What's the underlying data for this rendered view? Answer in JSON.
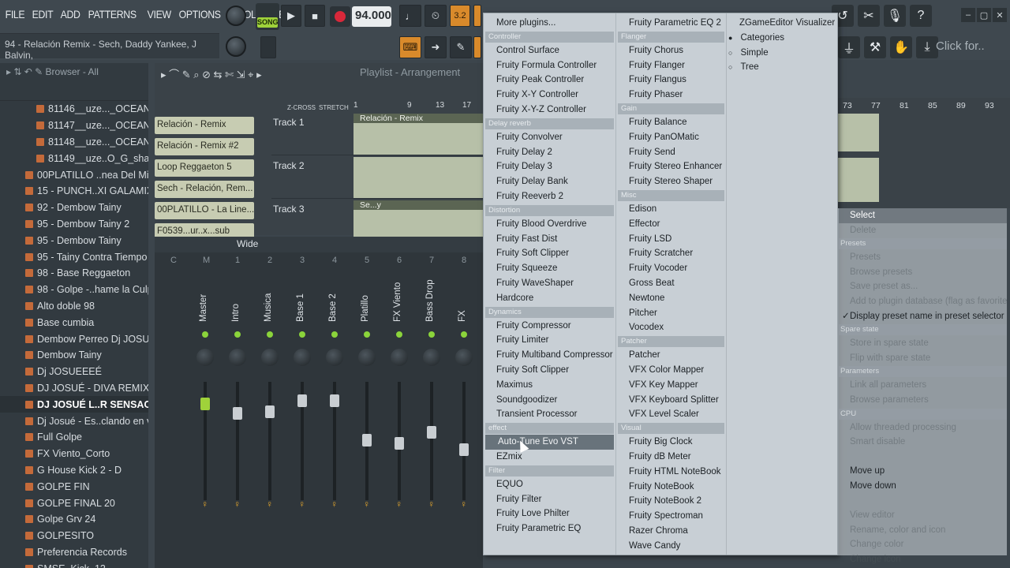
{
  "menubar": [
    "FILE",
    "EDIT",
    "ADD",
    "PATTERNS",
    "VIEW",
    "OPTIONS",
    "TOOLS",
    "HELP"
  ],
  "hint": "94 - Relación Remix - Sech, Daddy Yankee, J Balvin,",
  "transport": {
    "song_label": "SONG",
    "tempo": "94.000",
    "click_for": "Click for.."
  },
  "browser": {
    "title": "Browser - All",
    "items": [
      "81146__uze..._OCEANO_B",
      "81147__uze..._OCEANO_C",
      "81148__uze..._OCEANO_D",
      "81149__uze..O_G_sharp",
      "00PLATILLO ..nea Del Mix™",
      "15 - PUNCH..XI GALAMIXER )",
      "92 - Dembow Tainy",
      "95 - Dembow Tainy 2",
      "95 - Dembow Tainy",
      "95 - Tainy Contra Tiempo",
      "98 - Base Reggaeton",
      "98 - Golpe -..hame la Culpa",
      "Alto doble 98",
      "Base cumbia",
      "Dembow Perreo Dj JOSUÉ",
      "Dembow Tainy",
      "Dj JOSUEEEÉ",
      "DJ JOSUÉ - DIVA REMIX",
      "DJ JOSUÉ L..R SENSACION",
      "Dj Josué - Es..clando en vivo",
      "Full Golpe",
      "FX Viento_Corto",
      "G House Kick 2 - D",
      "GOLPE FIN",
      "GOLPE FINAL 20",
      "Golpe Grv 24",
      "GOLPESITO",
      "Preferencia Records",
      "SMSE_Kick_12"
    ]
  },
  "playlist": {
    "title": "Playlist - Arrangement",
    "patterns": [
      "Relación - Remix",
      "Relación - Remix #2",
      "Loop Reggaeton 5",
      "Sech - Relación, Rem...",
      "00PLATILLO - La Line...",
      "F0539...ur..x...sub"
    ],
    "tracks": [
      "Track 1",
      "Track 2",
      "Track 3"
    ],
    "clip_title": "Relación - Remix",
    "clip3_title": "Se...y",
    "ruler": [
      "1",
      "9",
      "13",
      "17"
    ],
    "ruler_right": [
      "73",
      "77",
      "81",
      "85",
      "89",
      "93"
    ],
    "zcross": "Z-CROSS",
    "stretch": "STRETCH"
  },
  "mixer": {
    "mode": "Wide",
    "col_heads": [
      "C",
      "M",
      "1",
      "2",
      "3",
      "4",
      "5",
      "6",
      "7",
      "8"
    ],
    "strips": [
      "Master",
      "Intro",
      "Musica",
      "Base 1",
      "Base 2",
      "Platillo",
      "FX Viento",
      "Bass Drop",
      "FX"
    ]
  },
  "plugin_menu": {
    "col1": [
      {
        "t": "More plugins...",
        "h": false,
        "top": true
      },
      {
        "t": "Controller",
        "h": true
      },
      {
        "t": "Control Surface"
      },
      {
        "t": "Fruity Formula Controller"
      },
      {
        "t": "Fruity Peak Controller"
      },
      {
        "t": "Fruity X-Y Controller"
      },
      {
        "t": "Fruity X-Y-Z Controller"
      },
      {
        "t": "Delay reverb",
        "h": true
      },
      {
        "t": "Fruity Convolver"
      },
      {
        "t": "Fruity Delay 2"
      },
      {
        "t": "Fruity Delay 3"
      },
      {
        "t": "Fruity Delay Bank"
      },
      {
        "t": "Fruity Reeverb 2"
      },
      {
        "t": "Distortion",
        "h": true
      },
      {
        "t": "Fruity Blood Overdrive"
      },
      {
        "t": "Fruity Fast Dist"
      },
      {
        "t": "Fruity Soft Clipper"
      },
      {
        "t": "Fruity Squeeze"
      },
      {
        "t": "Fruity WaveShaper"
      },
      {
        "t": "Hardcore"
      },
      {
        "t": "Dynamics",
        "h": true
      },
      {
        "t": "Fruity Compressor"
      },
      {
        "t": "Fruity Limiter"
      },
      {
        "t": "Fruity Multiband Compressor"
      },
      {
        "t": "Fruity Soft Clipper"
      },
      {
        "t": "Maximus"
      },
      {
        "t": "Soundgoodizer"
      },
      {
        "t": "Transient Processor"
      },
      {
        "t": "effect",
        "h": true
      },
      {
        "t": "Auto-Tune Evo VST",
        "hl": true
      },
      {
        "t": "EZmix"
      },
      {
        "t": "Filter",
        "h": true
      },
      {
        "t": "EQUO"
      },
      {
        "t": "Fruity Filter"
      },
      {
        "t": "Fruity Love Philter"
      },
      {
        "t": "Fruity Parametric EQ"
      }
    ],
    "col2": [
      {
        "t": "Fruity Parametric EQ 2"
      },
      {
        "t": "Flanger",
        "h": true
      },
      {
        "t": "Fruity Chorus"
      },
      {
        "t": "Fruity Flanger"
      },
      {
        "t": "Fruity Flangus"
      },
      {
        "t": "Fruity Phaser"
      },
      {
        "t": "Gain",
        "h": true
      },
      {
        "t": "Fruity Balance"
      },
      {
        "t": "Fruity PanOMatic"
      },
      {
        "t": "Fruity Send"
      },
      {
        "t": "Fruity Stereo Enhancer"
      },
      {
        "t": "Fruity Stereo Shaper"
      },
      {
        "t": "Misc",
        "h": true
      },
      {
        "t": "Edison"
      },
      {
        "t": "Effector"
      },
      {
        "t": "Fruity LSD"
      },
      {
        "t": "Fruity Scratcher"
      },
      {
        "t": "Fruity Vocoder"
      },
      {
        "t": "Gross Beat"
      },
      {
        "t": "Newtone"
      },
      {
        "t": "Pitcher"
      },
      {
        "t": "Vocodex"
      },
      {
        "t": "Patcher",
        "h": true
      },
      {
        "t": "Patcher"
      },
      {
        "t": "VFX Color Mapper"
      },
      {
        "t": "VFX Key Mapper"
      },
      {
        "t": "VFX Keyboard Splitter"
      },
      {
        "t": "VFX Level Scaler"
      },
      {
        "t": "Visual",
        "h": true
      },
      {
        "t": "Fruity Big Clock"
      },
      {
        "t": "Fruity dB Meter"
      },
      {
        "t": "Fruity HTML NoteBook"
      },
      {
        "t": "Fruity NoteBook"
      },
      {
        "t": "Fruity NoteBook 2"
      },
      {
        "t": "Fruity Spectroman"
      },
      {
        "t": "Razer Chroma"
      },
      {
        "t": "Wave Candy"
      }
    ],
    "col3": [
      {
        "t": "ZGameEditor Visualizer"
      },
      {
        "t": "Categories",
        "radio": true,
        "on": true
      },
      {
        "t": "Simple",
        "radio": true
      },
      {
        "t": "Tree",
        "radio": true
      }
    ]
  },
  "context_menu": [
    {
      "t": "Select",
      "sel": true
    },
    {
      "t": "Delete",
      "dim": true
    },
    {
      "t": "Presets",
      "h": true
    },
    {
      "t": "Presets",
      "dim": true
    },
    {
      "t": "Browse presets",
      "dim": true
    },
    {
      "t": "Save preset as...",
      "dim": true
    },
    {
      "t": "Add to plugin database (flag as favorite)",
      "dim": true
    },
    {
      "t": "Display preset name in preset selector",
      "chk": true
    },
    {
      "t": "Spare state",
      "h": true
    },
    {
      "t": "Store in spare state",
      "dim": true
    },
    {
      "t": "Flip with spare state",
      "dim": true
    },
    {
      "t": "Parameters",
      "h": true
    },
    {
      "t": "Link all parameters",
      "dim": true
    },
    {
      "t": "Browse parameters",
      "dim": true
    },
    {
      "t": "CPU",
      "h": true
    },
    {
      "t": "Allow threaded processing",
      "dim": true
    },
    {
      "t": "Smart disable",
      "dim": true
    },
    {
      "t": "",
      "dim": true
    },
    {
      "t": "Move up"
    },
    {
      "t": "Move down"
    },
    {
      "t": "",
      "dim": true
    },
    {
      "t": "View editor",
      "dim": true
    },
    {
      "t": "Rename, color and icon",
      "dim": true
    },
    {
      "t": "Change color",
      "dim": true
    },
    {
      "t": "Change icon",
      "dim": true
    }
  ]
}
